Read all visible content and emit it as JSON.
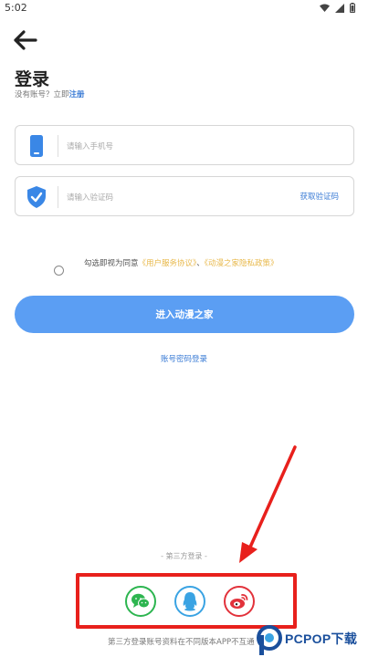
{
  "status_bar": {
    "time": "5:02"
  },
  "header": {
    "title": "登录"
  },
  "register": {
    "prompt": "没有账号？立即",
    "link": "注册"
  },
  "phone_field": {
    "placeholder": "请输入手机号"
  },
  "code_field": {
    "placeholder": "请输入验证码",
    "get_code_label": "获取验证码"
  },
  "agreement": {
    "prefix": "勾选即视为同意",
    "user_agreement": "《用户服务协议》",
    "separator": "、",
    "privacy_policy": "《动漫之家隐私政策》"
  },
  "login_button": {
    "label": "进入动漫之家"
  },
  "password_login": {
    "label": "账号密码登录"
  },
  "third_party": {
    "label": "- 第三方登录 -",
    "providers": [
      "wechat-icon",
      "qq-icon",
      "weibo-icon"
    ]
  },
  "bottom_note": {
    "text": "第三方登录账号资料在不同版本APP不互通"
  },
  "watermark": {
    "text": "PCPOP下载"
  },
  "colors": {
    "primary_button": "#5b9ef3",
    "link_blue": "#3a7bd5",
    "agreement_link": "#e8b84a",
    "annotation_red": "#e8201c",
    "wechat": "#2db550",
    "qq": "#3aa3e3",
    "weibo": "#e2323b"
  }
}
